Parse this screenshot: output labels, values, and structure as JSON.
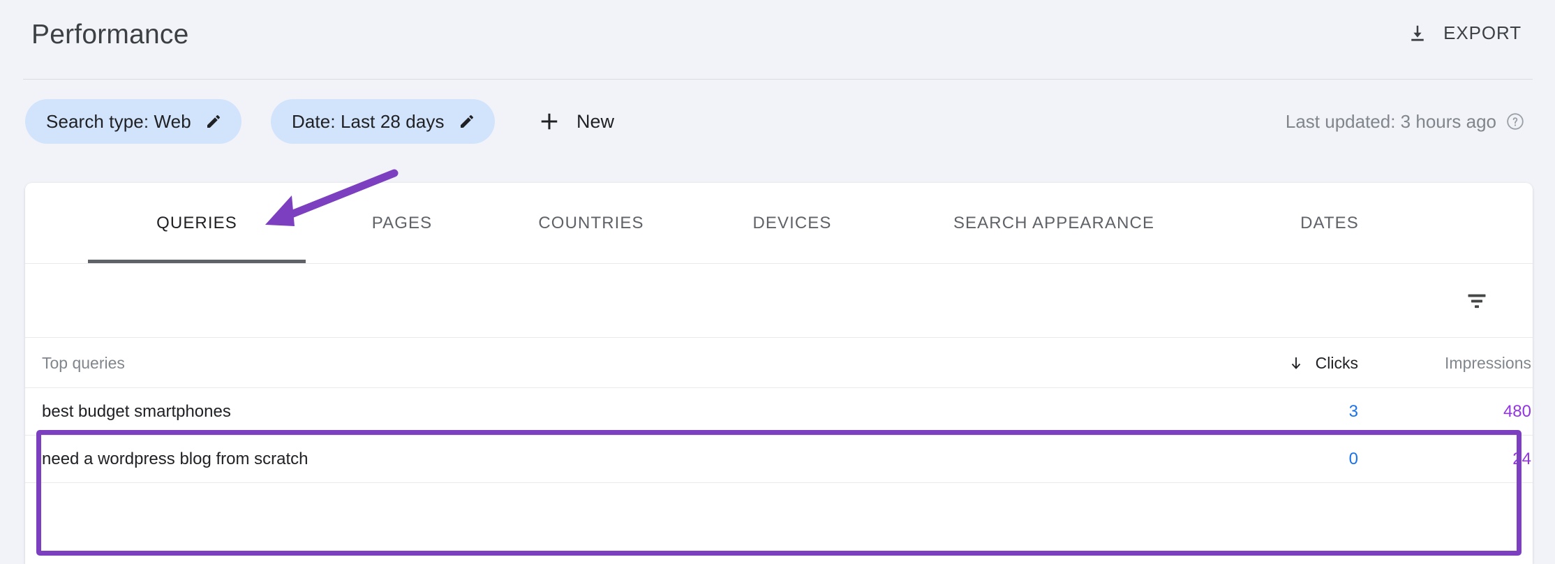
{
  "header": {
    "title": "Performance",
    "export_label": "EXPORT",
    "export_icon": "download-icon"
  },
  "filterbar": {
    "chips": [
      {
        "label": "Search type: Web",
        "edit_icon": "pencil-icon"
      },
      {
        "label": "Date: Last 28 days",
        "edit_icon": "pencil-icon"
      }
    ],
    "new_button": {
      "label": "New",
      "icon": "plus-icon"
    },
    "last_updated": {
      "text": "Last updated: 3 hours ago",
      "icon": "help-circle-icon"
    }
  },
  "card": {
    "tabs": [
      {
        "label": "QUERIES",
        "active": true
      },
      {
        "label": "PAGES",
        "active": false
      },
      {
        "label": "COUNTRIES",
        "active": false
      },
      {
        "label": "DEVICES",
        "active": false
      },
      {
        "label": "SEARCH APPEARANCE",
        "active": false
      },
      {
        "label": "DATES",
        "active": false
      }
    ],
    "filter_row": {
      "icon": "filter-icon"
    },
    "table": {
      "columns": {
        "query": "Top queries",
        "clicks": "Clicks",
        "impressions": "Impressions"
      },
      "sort": {
        "column": "Clicks",
        "direction": "descending",
        "icon": "arrow-down-icon"
      },
      "rows": [
        {
          "query": "best budget smartphones",
          "clicks": "3",
          "impressions": "480"
        },
        {
          "query": "need a wordpress blog from scratch",
          "clicks": "0",
          "impressions": "24"
        }
      ]
    }
  },
  "annotations": {
    "arrow_color": "#7b3fbf",
    "box_color": "#7b3fbf",
    "arrow_target": "QUERIES",
    "box_target": "table-rows"
  },
  "colors": {
    "page_background": "#f1f3f9",
    "card_background": "#ffffff",
    "chip_background": "#d2e3fc",
    "clicks_value": "#1a73e8",
    "impressions_value": "#9334e6",
    "active_tab": "#202124",
    "inactive_tab": "#5f6368"
  }
}
